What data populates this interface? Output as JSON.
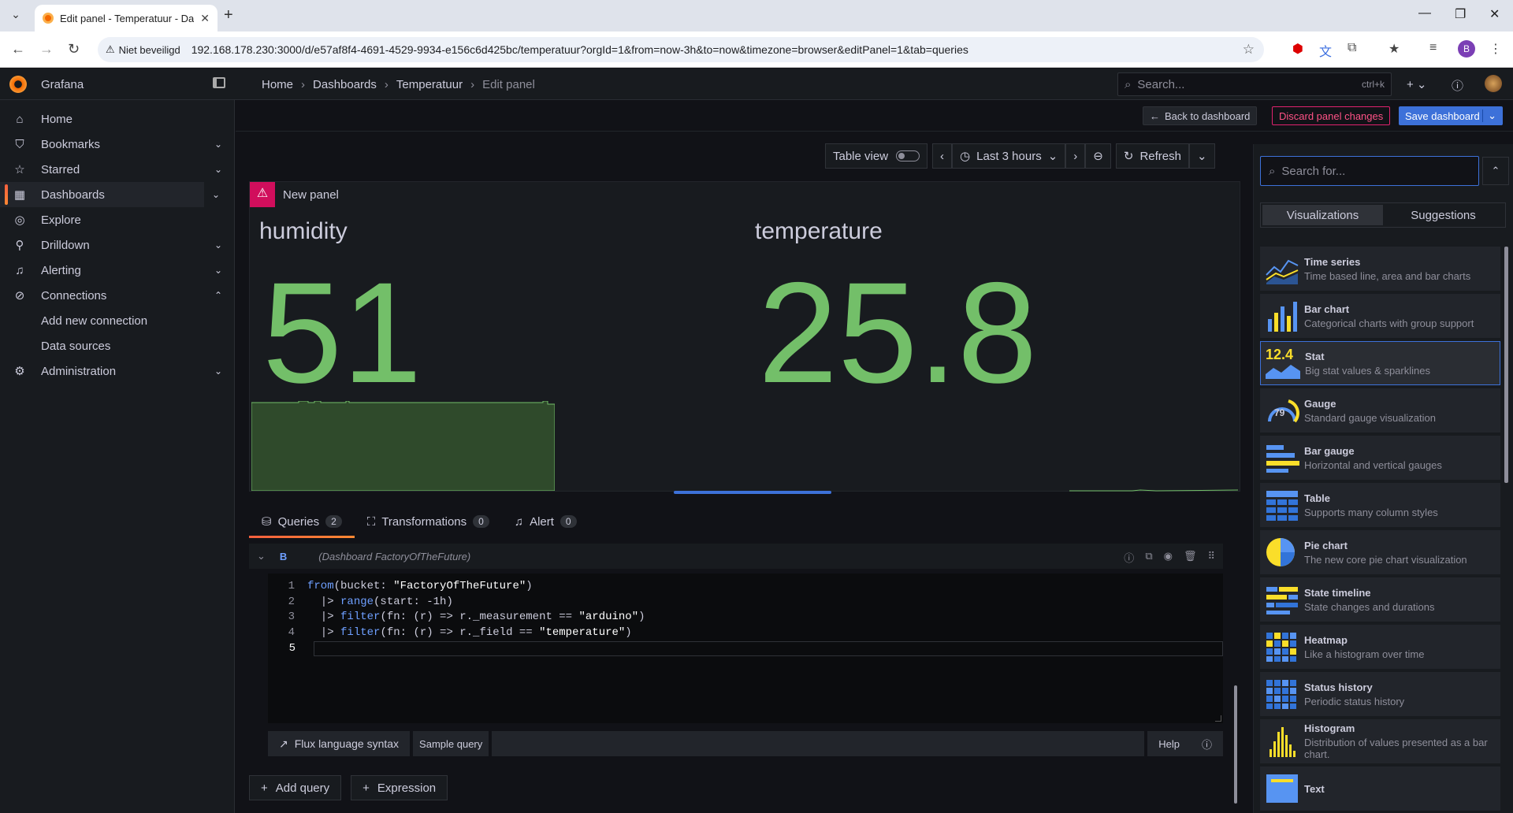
{
  "browser": {
    "tab_title": "Edit panel - Temperatuur - Das",
    "security_label": "Niet beveiligd",
    "url": "192.168.178.230:3000/d/e57af8f4-4691-4529-9934-e156c6d425bc/temperatuur?orgId=1&from=now-3h&to=now&timezone=browser&editPanel=1&tab=queries",
    "profile_initial": "B"
  },
  "topbar": {
    "brand": "Grafana",
    "breadcrumb": [
      "Home",
      "Dashboards",
      "Temperatuur",
      "Edit panel"
    ],
    "search_placeholder": "Search...",
    "search_shortcut": "ctrl+k"
  },
  "sidebar": {
    "items": [
      {
        "label": "Home",
        "icon": "home-icon"
      },
      {
        "label": "Bookmarks",
        "icon": "bookmark-icon"
      },
      {
        "label": "Starred",
        "icon": "star-icon"
      },
      {
        "label": "Dashboards",
        "icon": "apps-icon"
      },
      {
        "label": "Explore",
        "icon": "compass-icon"
      },
      {
        "label": "Drilldown",
        "icon": "drilldown-icon"
      },
      {
        "label": "Alerting",
        "icon": "bell-icon"
      },
      {
        "label": "Connections",
        "icon": "link-icon"
      },
      {
        "label": "Administration",
        "icon": "cog-icon"
      }
    ],
    "sub_items": [
      "Add new connection",
      "Data sources"
    ]
  },
  "actions": {
    "back": "Back to dashboard",
    "discard": "Discard panel changes",
    "save": "Save dashboard"
  },
  "timebar": {
    "table_view": "Table view",
    "range": "Last 3 hours",
    "refresh": "Refresh"
  },
  "panel": {
    "title": "New panel",
    "stats": [
      {
        "name": "humidity",
        "value": "51"
      },
      {
        "name": "temperature",
        "value": "25.8"
      }
    ]
  },
  "query_tabs": [
    {
      "label": "Queries",
      "count": "2"
    },
    {
      "label": "Transformations",
      "count": "0"
    },
    {
      "label": "Alert",
      "count": "0"
    }
  ],
  "query": {
    "ref_id": "B",
    "datasource": "(Dashboard FactoryOfTheFuture)",
    "lines": [
      {
        "n": "1",
        "parts": [
          [
            "fn",
            "from"
          ],
          [
            "txt",
            "(bucket: "
          ],
          [
            "str",
            "\"FactoryOfTheFuture\""
          ],
          [
            "txt",
            ")"
          ]
        ]
      },
      {
        "n": "2",
        "parts": [
          [
            "txt",
            "  |> "
          ],
          [
            "fn",
            "range"
          ],
          [
            "txt",
            "(start: -1h)"
          ]
        ]
      },
      {
        "n": "3",
        "parts": [
          [
            "txt",
            "  |> "
          ],
          [
            "fn",
            "filter"
          ],
          [
            "txt",
            "(fn: (r) => r._measurement == "
          ],
          [
            "str",
            "\"arduino\""
          ],
          [
            "txt",
            ")"
          ]
        ]
      },
      {
        "n": "4",
        "parts": [
          [
            "txt",
            "  |> "
          ],
          [
            "fn",
            "filter"
          ],
          [
            "txt",
            "(fn: (r) => r._field == "
          ],
          [
            "str",
            "\"temperature\""
          ],
          [
            "txt",
            ")"
          ]
        ]
      },
      {
        "n": "5",
        "parts": []
      }
    ],
    "footer": {
      "syntax": "Flux language syntax",
      "sample": "Sample query",
      "help": "Help"
    }
  },
  "add_buttons": {
    "query": "Add query",
    "expression": "Expression"
  },
  "viz": {
    "search_placeholder": "Search for...",
    "tabs": [
      "Visualizations",
      "Suggestions"
    ],
    "items": [
      {
        "name": "Time series",
        "desc": "Time based line, area and bar charts",
        "icon": "time-series-icon"
      },
      {
        "name": "Bar chart",
        "desc": "Categorical charts with group support",
        "icon": "bar-chart-icon"
      },
      {
        "name": "Stat",
        "desc": "Big stat values & sparklines",
        "icon": "stat-icon",
        "selected": true,
        "icon_text": "12.4"
      },
      {
        "name": "Gauge",
        "desc": "Standard gauge visualization",
        "icon": "gauge-icon",
        "icon_text": "79"
      },
      {
        "name": "Bar gauge",
        "desc": "Horizontal and vertical gauges",
        "icon": "bar-gauge-icon"
      },
      {
        "name": "Table",
        "desc": "Supports many column styles",
        "icon": "table-icon"
      },
      {
        "name": "Pie chart",
        "desc": "The new core pie chart visualization",
        "icon": "pie-chart-icon"
      },
      {
        "name": "State timeline",
        "desc": "State changes and durations",
        "icon": "state-timeline-icon"
      },
      {
        "name": "Heatmap",
        "desc": "Like a histogram over time",
        "icon": "heatmap-icon"
      },
      {
        "name": "Status history",
        "desc": "Periodic status history",
        "icon": "status-history-icon"
      },
      {
        "name": "Histogram",
        "desc": "Distribution of values presented as a bar chart.",
        "icon": "histogram-icon"
      },
      {
        "name": "Text",
        "desc": "",
        "icon": "text-icon"
      }
    ]
  },
  "colors": {
    "accent": "#3d71d9",
    "stat_green": "#73bf69",
    "danger": "#e0226e"
  }
}
